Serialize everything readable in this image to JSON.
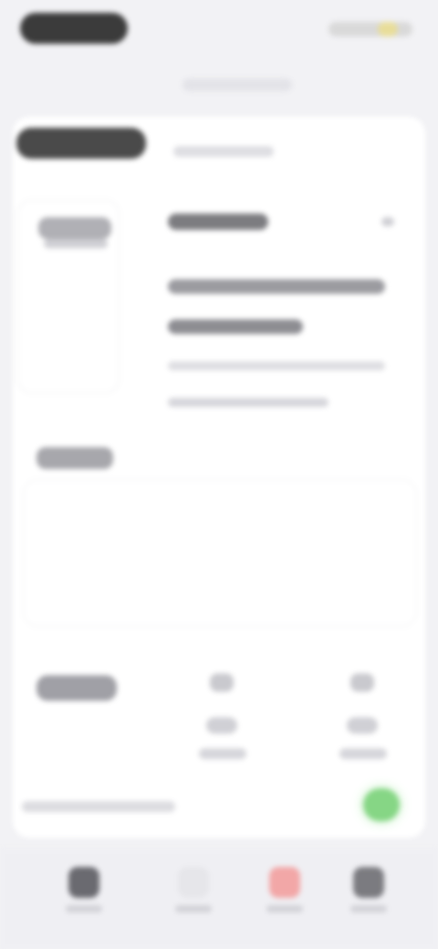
{
  "status_bar": {
    "time": "",
    "indicators": [
      "signal-icon",
      "wifi-icon",
      "battery-icon"
    ]
  },
  "browser": {
    "url": ""
  },
  "page": {
    "title": "",
    "subtitle": ""
  },
  "sidebar": {
    "label": "",
    "sublabel": ""
  },
  "info": {
    "title": "",
    "line1": "",
    "line2": "",
    "line3": "",
    "line4": ""
  },
  "section2": {
    "label": ""
  },
  "section3": {
    "label": "",
    "stats": [
      {
        "top": "",
        "value": "",
        "caption": ""
      },
      {
        "top": "",
        "value": "",
        "caption": ""
      }
    ]
  },
  "footer": {
    "note": ""
  },
  "colors": {
    "background": "#f2f2f5",
    "accent_green": "#86d685",
    "accent_red": "#f2a7a7",
    "dark": "#3b3b3b"
  },
  "tabs": [
    {
      "label": "",
      "icon": "home-icon",
      "color": "#6a6a70"
    },
    {
      "label": "",
      "icon": "profile-icon",
      "color": "#e6e6ea"
    },
    {
      "label": "",
      "icon": "record-icon",
      "color": "#f2a7a7"
    },
    {
      "label": "",
      "icon": "settings-icon",
      "color": "#7b7b80"
    }
  ]
}
